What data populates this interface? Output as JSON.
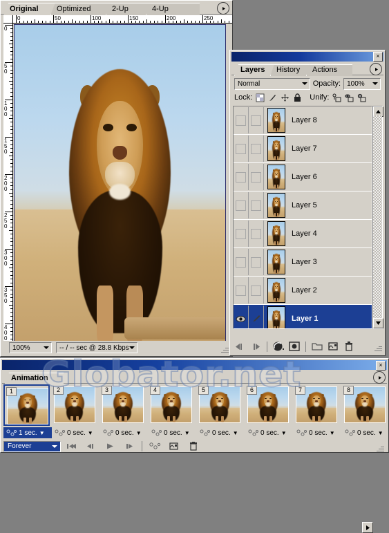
{
  "document_window": {
    "tabs": [
      {
        "label": "Original",
        "active": true
      },
      {
        "label": "Optimized",
        "active": false
      },
      {
        "label": "2-Up",
        "active": false
      },
      {
        "label": "4-Up",
        "active": false
      }
    ],
    "menu_arrow_icon": "palette-menu-arrow-icon",
    "ruler": {
      "horizontal_labels": [
        "0",
        "50",
        "100",
        "150",
        "200",
        "250"
      ],
      "vertical_labels": [
        "0",
        "50",
        "100",
        "150",
        "200",
        "250",
        "300",
        "350",
        "400"
      ]
    },
    "status": {
      "zoom_value": "100%",
      "download_value": "-- / -- sec @ 28.8 Kbps"
    },
    "image_subject": "lion-photograph"
  },
  "layers_palette": {
    "close_label": "×",
    "tabs": [
      {
        "label": "Layers",
        "active": true
      },
      {
        "label": "History",
        "active": false
      },
      {
        "label": "Actions",
        "active": false
      }
    ],
    "menu_arrow_icon": "palette-menu-arrow-icon",
    "blend_mode": "Normal",
    "opacity_label": "Opacity:",
    "opacity_value": "100%",
    "lock_label": "Lock:",
    "unify_label": "Unify:",
    "lock_icons": [
      "lock-transparency-icon",
      "lock-paint-icon",
      "lock-position-icon",
      "lock-all-icon"
    ],
    "unify_icons": [
      "unify-position-icon",
      "unify-visibility-icon",
      "unify-style-icon"
    ],
    "layers": [
      {
        "name": "Layer 8",
        "visible": false,
        "selected": false
      },
      {
        "name": "Layer 7",
        "visible": false,
        "selected": false
      },
      {
        "name": "Layer 6",
        "visible": false,
        "selected": false
      },
      {
        "name": "Layer 5",
        "visible": false,
        "selected": false
      },
      {
        "name": "Layer 4",
        "visible": false,
        "selected": false
      },
      {
        "name": "Layer 3",
        "visible": false,
        "selected": false
      },
      {
        "name": "Layer 2",
        "visible": false,
        "selected": false
      },
      {
        "name": "Layer 1",
        "visible": true,
        "selected": true
      }
    ],
    "footer_icons": [
      "previous-frame-icon",
      "next-frame-icon",
      "layer-style-icon",
      "add-mask-icon",
      "new-group-icon",
      "new-layer-icon",
      "delete-layer-icon"
    ],
    "scroll_up_icon": "scroll-up-arrow-icon",
    "scroll_down_icon": "scroll-down-arrow-icon"
  },
  "animation_palette": {
    "close_label": "×",
    "tabs": [
      {
        "label": "Animation",
        "active": true
      }
    ],
    "menu_arrow_icon": "palette-menu-arrow-icon",
    "watermark_text": "Globator.net",
    "frames": [
      {
        "number": "1",
        "delay": "1 sec.",
        "selected": true
      },
      {
        "number": "2",
        "delay": "0 sec.",
        "selected": false
      },
      {
        "number": "3",
        "delay": "0 sec.",
        "selected": false
      },
      {
        "number": "4",
        "delay": "0 sec.",
        "selected": false
      },
      {
        "number": "5",
        "delay": "0 sec.",
        "selected": false
      },
      {
        "number": "6",
        "delay": "0 sec.",
        "selected": false
      },
      {
        "number": "7",
        "delay": "0 sec.",
        "selected": false
      },
      {
        "number": "8",
        "delay": "0 sec.",
        "selected": false
      }
    ],
    "loop_value": "Forever",
    "control_icons": [
      "rewind-to-first-icon",
      "step-backward-icon",
      "play-icon",
      "step-forward-icon",
      "tween-icon",
      "duplicate-frame-icon",
      "delete-frame-icon"
    ],
    "scroll_right_icon": "scroll-right-arrow-icon"
  },
  "colors": {
    "chrome": "#d4d0c8",
    "selection": "#1c3f94",
    "title_bar": "#0a246a",
    "desktop": "#808080"
  }
}
